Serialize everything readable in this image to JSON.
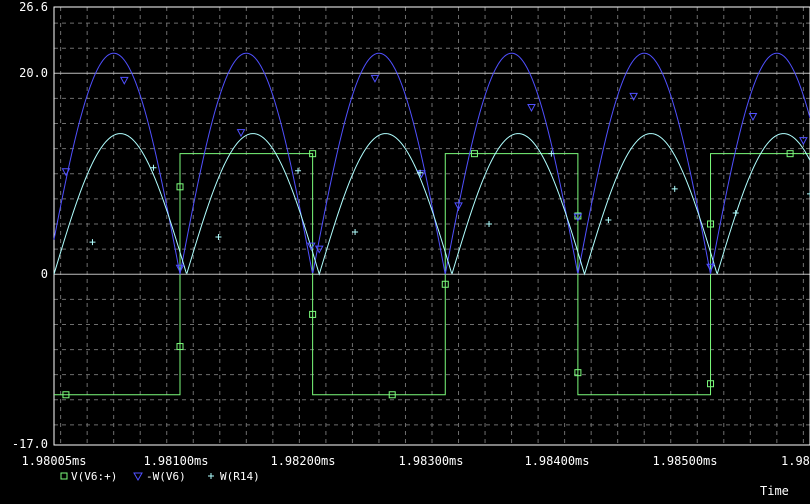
{
  "chart_data": {
    "type": "line",
    "title": "",
    "xlabel": "Time",
    "ylabel": "",
    "xlim": [
      1.98005,
      1.98575
    ],
    "ylim": [
      -17.0,
      26.6
    ],
    "x_unit": "ms",
    "grid": true,
    "background": "#000000",
    "x_ticks": [
      "1.98005ms",
      "1.98100ms",
      "1.98200ms",
      "1.98300ms",
      "1.98400ms",
      "1.98500ms",
      "1.98"
    ],
    "y_ticks": [
      "26.6",
      "20.0",
      "0",
      "-17.0"
    ],
    "legend": {
      "placement": "bottom-left",
      "entries": [
        {
          "marker": "square",
          "label": "V(V6:+)",
          "color": "#7CFC7C"
        },
        {
          "marker": "triangle-down",
          "label": "-W(V6)",
          "color": "#5050FF"
        },
        {
          "marker": "plus",
          "label": "W(R14)",
          "color": "#B0FFFF"
        }
      ]
    },
    "series": [
      {
        "name": "V(V6:+)",
        "color": "#7CFC7C",
        "marker": "square",
        "x": [
          1.98005,
          1.981,
          1.981,
          1.982,
          1.982,
          1.983,
          1.983,
          1.984,
          1.984,
          1.985,
          1.985,
          1.98575
        ],
        "y": [
          -12.0,
          -12.0,
          12.0,
          12.0,
          -12.0,
          -12.0,
          12.0,
          12.0,
          -12.0,
          -12.0,
          12.0,
          12.0
        ],
        "marker_x": [
          1.98014,
          1.981,
          1.981,
          1.982,
          1.982,
          1.9826,
          1.983,
          1.98322,
          1.984,
          1.984,
          1.985,
          1.985,
          1.9856
        ],
        "marker_y": [
          -12.0,
          -7.2,
          8.7,
          12.0,
          -4.0,
          -12.0,
          -1.0,
          12.0,
          -9.8,
          5.8,
          5.0,
          -10.9,
          12.0
        ]
      },
      {
        "name": "-W(V6)",
        "color": "#5050FF",
        "marker": "triangle-down",
        "amplitude": 22.0,
        "period_ms": 0.001,
        "baseline": 0,
        "zero_at_ms": 1.98,
        "marker_x": [
          1.98014,
          1.98058,
          1.981,
          1.98146,
          1.98199,
          1.98205,
          1.98247,
          1.98282,
          1.9831,
          1.98365,
          1.984,
          1.98442,
          1.985,
          1.98532,
          1.9857
        ],
        "marker_y": [
          10.2,
          19.3,
          0.6,
          14.1,
          2.8,
          2.5,
          19.5,
          10.0,
          6.8,
          16.6,
          5.7,
          17.7,
          0.7,
          15.7,
          13.3
        ]
      },
      {
        "name": "W(R14)",
        "color": "#B0FFFF",
        "marker": "plus",
        "amplitude": 14.0,
        "period_ms": 0.001,
        "baseline": 0,
        "zero_at_ms": 1.98005,
        "marker_x": [
          1.98034,
          1.9808,
          1.98129,
          1.98189,
          1.98232,
          1.98281,
          1.98333,
          1.9838,
          1.98423,
          1.98473,
          1.98519,
          1.98575
        ],
        "marker_y": [
          3.2,
          10.6,
          3.7,
          10.3,
          4.2,
          10.1,
          5.0,
          12.0,
          5.4,
          8.5,
          6.1,
          8.0
        ]
      }
    ]
  }
}
